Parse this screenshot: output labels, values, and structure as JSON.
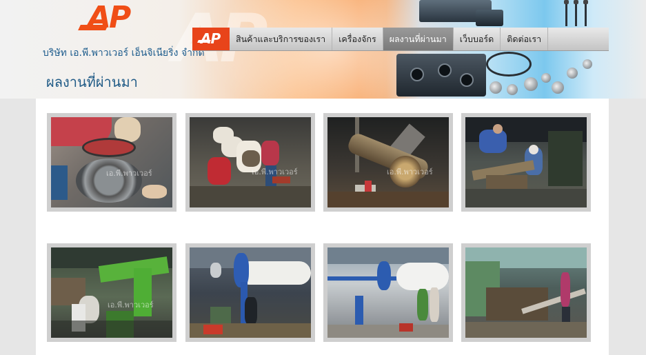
{
  "header": {
    "logo_text": "AP",
    "company_name": "บริษัท เอ.พี.พาวเวอร์ เอ็นจิเนียริ่ง จำกัด"
  },
  "nav": {
    "logo_text": "AP",
    "items": [
      {
        "label": "สินค้าและบริการของเรา",
        "active": false
      },
      {
        "label": "เครื่องจักร",
        "active": false
      },
      {
        "label": "ผลงานที่ผ่านมา",
        "active": true
      },
      {
        "label": "เว็บบอร์ด",
        "active": false
      },
      {
        "label": "ติดต่อเรา",
        "active": false
      }
    ]
  },
  "page": {
    "title": "ผลงานที่ผ่านมา"
  },
  "gallery": {
    "watermark": "เอ.พี.พาวเวอร์",
    "items": [
      {
        "subject": "worker-sealing-ring"
      },
      {
        "subject": "workers-rollers-floor"
      },
      {
        "subject": "shaft-assembly"
      },
      {
        "subject": "workers-shaft-repair"
      },
      {
        "subject": "green-hydraulic-machine"
      },
      {
        "subject": "blue-roller-lift"
      },
      {
        "subject": "blue-roller-lift-wide"
      },
      {
        "subject": "long-shaft-workshop"
      }
    ]
  },
  "colors": {
    "brand_orange": "#f04e16",
    "title_blue": "#1f5a86",
    "nav_active": "#8a8a8a"
  }
}
